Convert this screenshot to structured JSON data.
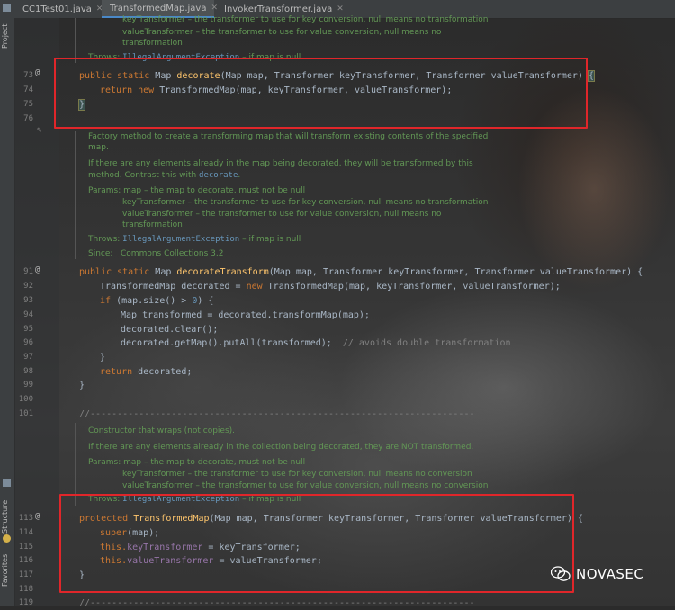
{
  "tool_window": {
    "project_label": "Project",
    "structure_label": "Structure",
    "favorites_label": "Favorites"
  },
  "tabs": [
    {
      "label": "CC1Test01.java",
      "active": false
    },
    {
      "label": "TransformedMap.java",
      "active": true
    },
    {
      "label": "InvokerTransformer.java",
      "active": false
    }
  ],
  "doc_top": {
    "line1": "keyTransformer – the transformer to use for key conversion, null means no transformation",
    "line2": "valueTransformer – the transformer to use for value conversion, null means no",
    "line3": "transformation",
    "throws_label": "Throws:",
    "throws_link": "IllegalArgumentException",
    "throws_text": " – if map is null"
  },
  "line_numbers": {
    "l73": "73",
    "l74": "74",
    "l75": "75",
    "l76": "76",
    "l91": "91",
    "l92": "92",
    "l93": "93",
    "l94": "94",
    "l95": "95",
    "l96": "96",
    "l97": "97",
    "l98": "98",
    "l99": "99",
    "l100": "100",
    "l101": "101",
    "l113": "113",
    "l114": "114",
    "l115": "115",
    "l116": "116",
    "l117": "117",
    "l118": "118",
    "l119": "119"
  },
  "code": {
    "l73": {
      "a": "public static ",
      "b": "Map ",
      "c": "decorate",
      "d": "(Map map, Transformer keyTransformer, Transformer valueTransformer) ",
      "e": "{"
    },
    "l74": {
      "a": "return new ",
      "b": "TransformedMap(map, keyTransformer, valueTransformer);"
    },
    "l75": "}",
    "l91": {
      "a": "public static ",
      "b": "Map ",
      "c": "decorateTransform",
      "d": "(Map map, Transformer keyTransformer, Transformer valueTransformer) {"
    },
    "l92": {
      "a": "TransformedMap decorated = ",
      "b": "new ",
      "c": "TransformedMap(map, keyTransformer, valueTransformer);"
    },
    "l93": {
      "a": "if ",
      "b": "(map.size() > ",
      "c": "0",
      "d": ") {"
    },
    "l94": "Map transformed = decorated.transformMap(map);",
    "l95": "decorated.clear();",
    "l96": {
      "a": "decorated.getMap().putAll(transformed);  ",
      "b": "// avoids double transformation"
    },
    "l97": "}",
    "l98": {
      "a": "return ",
      "b": "decorated;"
    },
    "l99": "}",
    "l101": "//-----------------------------------------------------------------------",
    "l113": {
      "a": "protected ",
      "b": "TransformedMap",
      "c": "(Map map, Transformer keyTransformer, Transformer valueTransformer) {"
    },
    "l114": {
      "a": "super",
      "b": "(map);"
    },
    "l115": {
      "a": "this.",
      "b": "keyTransformer",
      "c": " = keyTransformer;"
    },
    "l116": {
      "a": "this.",
      "b": "valueTransformer",
      "c": " = valueTransformer;"
    },
    "l117": "}",
    "l119": "//-----------------------------------------------------------------------"
  },
  "doc_mid": {
    "p1a": "Factory method to create a transforming map that will transform existing contents of the specified",
    "p1b": "map.",
    "p2a": "If there are any elements already in the map being decorated, they will be transformed by this",
    "p2b": "method. Contrast this with ",
    "p2link": "decorate",
    "p2end": ".",
    "params_label": "Params:",
    "param1": " map – the map to decorate, must not be null",
    "param2": "keyTransformer – the transformer to use for key conversion, null means no transformation",
    "param3": "valueTransformer – the transformer to use for value conversion, null means no",
    "param4": "transformation",
    "throws_label": "Throws:",
    "throws_link": "IllegalArgumentException",
    "throws_text": " – if map is null",
    "since_label": "Since:",
    "since_text": "   Commons Collections 3.2"
  },
  "doc_ctor": {
    "p1": "Constructor that wraps (not copies).",
    "p2": "If there are any elements already in the collection being decorated, they are NOT transformed.",
    "params_label": "Params:",
    "param1": " map – the map to decorate, must not be null",
    "param2": "keyTransformer – the transformer to use for key conversion, null means no conversion",
    "param3": "valueTransformer – the transformer to use for value conversion, null means no conversion",
    "throws_label": "Throws:",
    "throws_link": "IllegalArgumentException",
    "throws_text": " – if map is null"
  },
  "watermark": {
    "text": "NOVASEC"
  },
  "colors": {
    "highlight_box": "#e0262a",
    "doc_green": "#629755",
    "keyword": "#cc7832"
  }
}
